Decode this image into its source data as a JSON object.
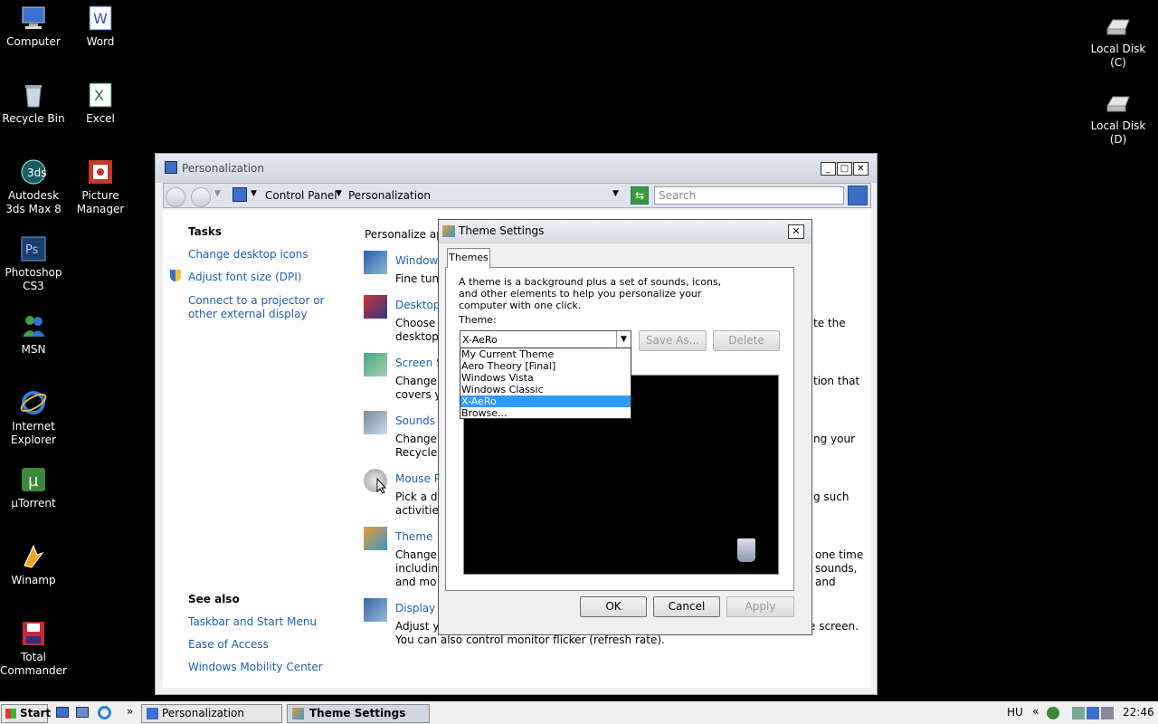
{
  "desktop": {
    "left_icons": [
      {
        "label": "Computer",
        "icon": "computer-icon"
      },
      {
        "label": "Word",
        "icon": "word-icon"
      },
      {
        "label": "Recycle Bin",
        "icon": "recycle-bin-icon"
      },
      {
        "label": "Excel",
        "icon": "excel-icon"
      },
      {
        "label": "Autodesk 3ds Max 8",
        "icon": "3dsmax-icon"
      },
      {
        "label": "Picture Manager",
        "icon": "picture-manager-icon"
      },
      {
        "label": "Photoshop CS3",
        "icon": "photoshop-icon"
      },
      {
        "label": "MSN",
        "icon": "msn-icon"
      },
      {
        "label": "Internet Explorer",
        "icon": "ie-icon"
      },
      {
        "label": "µTorrent",
        "icon": "utorrent-icon"
      },
      {
        "label": "Winamp",
        "icon": "winamp-icon"
      },
      {
        "label": "Total Commander",
        "icon": "total-commander-icon"
      }
    ],
    "right_icons": [
      {
        "label": "Local Disk (C)",
        "icon": "disk-icon"
      },
      {
        "label": "Local Disk (D)",
        "icon": "disk-icon"
      }
    ]
  },
  "window": {
    "title": "Personalization",
    "address": {
      "root": "Control Panel",
      "current": "Personalization"
    },
    "search_placeholder": "Search",
    "tasks": {
      "heading": "Tasks",
      "links": [
        "Change desktop icons",
        "Adjust font size (DPI)",
        "Connect to a projector or other external display"
      ]
    },
    "see_also": {
      "heading": "See also",
      "links": [
        "Taskbar and Start Menu",
        "Ease of Access",
        "Windows Mobility Center"
      ]
    },
    "main_heading": "Personalize ap",
    "sections": [
      {
        "title": "Window",
        "line1": "Fine tun",
        "right1": "",
        "right2": ""
      },
      {
        "title": "Desktop",
        "line1": "Choose",
        "line2": "desktop",
        "right1": "te the"
      },
      {
        "title": "Screen S",
        "line1": "Change",
        "line2": "covers y",
        "right1": "tion that"
      },
      {
        "title": "Sounds",
        "line1": "Change",
        "line2": "Recycle",
        "right1": "ng your"
      },
      {
        "title": "Mouse P",
        "line1": "Pick a d",
        "line2": "activitie",
        "right1": "g such"
      },
      {
        "title": "Theme",
        "line1": "Change",
        "line2": "includin",
        "line3": "and mo",
        "right1": "one time",
        "right2": "sounds,",
        "right3": "and"
      },
      {
        "title": "Display",
        "line1": "Adjust y",
        "line2": "You can also control monitor flicker (refresh rate).",
        "right1": "e screen."
      }
    ]
  },
  "dialog": {
    "title": "Theme Settings",
    "tab": "Themes",
    "description": "A theme is a background plus a set of sounds, icons, and other elements to help you personalize your computer with one click.",
    "theme_label": "Theme:",
    "theme_value": "X-AeRo",
    "save_as": "Save As...",
    "delete": "Delete",
    "options": [
      "My Current Theme",
      "Aero Theory [Final]",
      "Windows Vista",
      "Windows Classic",
      "X-AeRo",
      "Browse..."
    ],
    "selected_index": 4,
    "ok": "OK",
    "cancel": "Cancel",
    "apply": "Apply"
  },
  "taskbar": {
    "start": "Start",
    "items": [
      "Personalization",
      "Theme Settings"
    ],
    "lang": "HU",
    "time": "22:46"
  }
}
